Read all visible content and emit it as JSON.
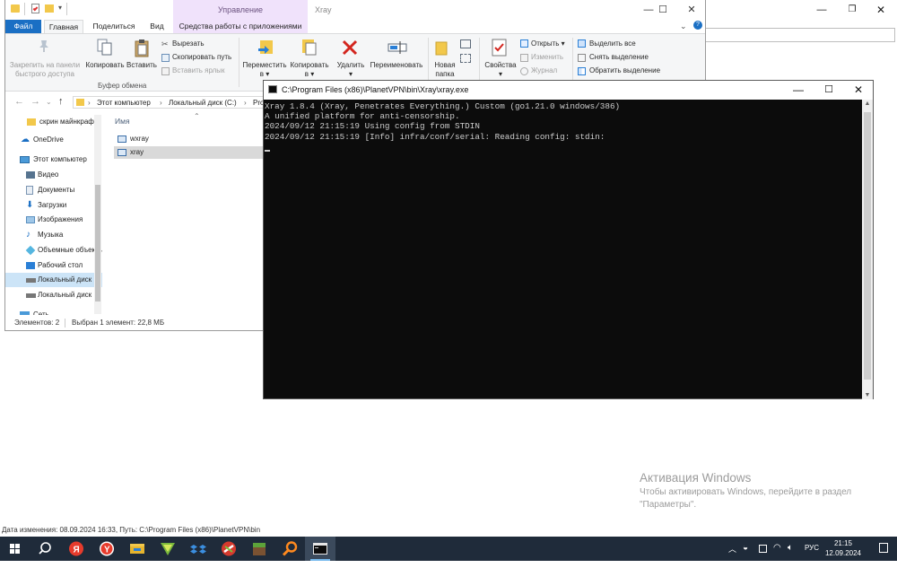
{
  "explorer": {
    "context_tab_title": "Управление",
    "window_title": "Xray",
    "tabs": {
      "file": "Файл",
      "home": "Главная",
      "share": "Поделиться",
      "view": "Вид",
      "app_tools": "Средства работы с приложениями"
    },
    "ribbon": {
      "pin_line1": "Закрепить на панели",
      "pin_line2": "быстрого доступа",
      "copy": "Копировать",
      "paste": "Вставить",
      "cut": "Вырезать",
      "copy_path": "Скопировать путь",
      "paste_shortcut": "Вставить ярлык",
      "clipboard_group": "Буфер обмена",
      "move_line1": "Переместить",
      "move_line2": "в ▾",
      "copyto_line1": "Копировать",
      "copyto_line2": "в ▾",
      "delete": "Удалить",
      "delete_arrow": "▾",
      "rename": "Переименовать",
      "new_folder_line1": "Новая",
      "new_folder_line2": "папка",
      "properties": "Свойства",
      "properties_arrow": "▾",
      "open": "Открыть ▾",
      "edit": "Изменить",
      "history": "Журнал",
      "select_all": "Выделить все",
      "select_none": "Снять выделение",
      "invert_selection": "Обратить выделение"
    },
    "address": {
      "this_pc": "Этот компьютер",
      "local_disk": "Локальный диск (C:)",
      "trunc": "Pro"
    },
    "nav_items": [
      "скрин майнкрафт",
      "OneDrive",
      "Этот компьютер",
      "Видео",
      "Документы",
      "Загрузки",
      "Изображения",
      "Музыка",
      "Объемные объекты",
      "Рабочий стол",
      "Локальный диск",
      "Локальный диск",
      "Сеть"
    ],
    "column_name": "Имя",
    "files": [
      "wxray",
      "xray"
    ],
    "status_items": "Элементов: 2",
    "status_selected": "Выбран 1 элемент: 22,8 МБ"
  },
  "console": {
    "title": "C:\\Program Files (x86)\\PlanetVPN\\bin\\Xray\\xray.exe",
    "lines": [
      "Xray 1.8.4 (Xray, Penetrates Everything.) Custom (go1.21.0 windows/386)",
      "A unified platform for anti-censorship.",
      "2024/09/12 21:15:19 Using config from STDIN",
      "2024/09/12 21:15:19 [Info] infra/conf/serial: Reading config: stdin:"
    ]
  },
  "activation": {
    "title": "Активация Windows",
    "line1": "Чтобы активировать Windows, перейдите в раздел",
    "line2": "\"Параметры\"."
  },
  "bottom_status": "Дата изменения: 08.09.2024 16:33, Путь: C:\\Program Files (x86)\\PlanetVPN\\bin",
  "taskbar": {
    "lang": "РУС",
    "time": "21:15",
    "date": "12.09.2024"
  },
  "colors": {
    "accent": "#1a6fc4",
    "console_bg": "#0c0c0c",
    "taskbar_bg": "#1f2b3a"
  }
}
